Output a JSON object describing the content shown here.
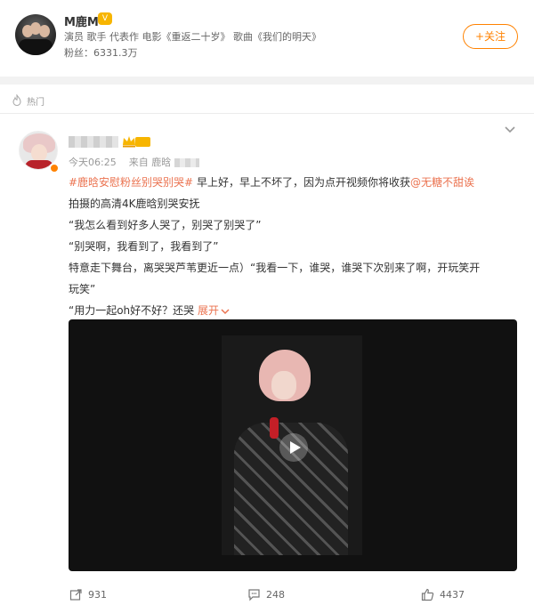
{
  "header": {
    "name": "M鹿M",
    "vip_label": "V",
    "description": "演员 歌手 代表作 电影《重返二十岁》 歌曲《我们的明天》",
    "fans": "粉丝：6331.3万",
    "follow_label": "+关注"
  },
  "post": {
    "section_label": "热门",
    "meta_time": "今天06:25",
    "meta_source": "来自 鹿晗",
    "lines": {
      "l1_tag": "#鹿晗安慰粉丝别哭别哭#",
      "l1_text": " 早上好，早上不坏了，因为点开视频你将收获",
      "l1_mention": "@无糖不甜诶",
      "l2": "拍摄的高清4K鹿晗别哭安抚",
      "l3": "“我怎么看到好多人哭了，别哭了别哭了”",
      "l4": "“别哭啊，我看到了，我看到了”",
      "l5": "特意走下舞台，离哭哭芦苇更近一点）“我看一下，谁哭，谁哭下次别来了啊，开玩笑开",
      "l6": "玩笑”",
      "l7": "“用力一起oh好不好？还哭 ",
      "expand": "展开"
    },
    "actions": {
      "share": "931",
      "comment": "248",
      "like": "4437"
    }
  },
  "colors": {
    "accent": "#ff8200",
    "link": "#eb7350"
  }
}
